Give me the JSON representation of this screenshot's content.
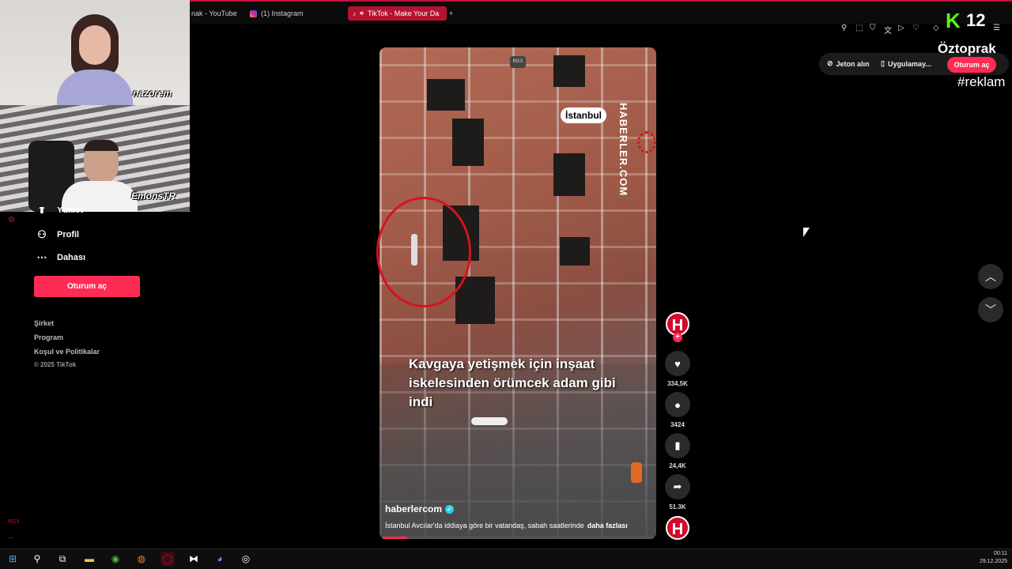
{
  "browser": {
    "tabs": [
      {
        "label": "nak - YouTube",
        "icon": "youtube-icon"
      },
      {
        "label": "(1) Instagram",
        "icon": "instagram-icon"
      },
      {
        "label": "TikTok - Make Your Da",
        "icon": "tiktok-icon",
        "active": true
      }
    ],
    "new_tab": "+"
  },
  "webcams": {
    "cam1_label": "nazorem",
    "cam2_label": "EmonsTR"
  },
  "sidebar": {
    "partial_item": "Yüklet",
    "items": [
      {
        "label": "Profil",
        "icon": "person-icon"
      },
      {
        "label": "Dahası",
        "icon": "more-icon"
      }
    ],
    "login_button": "Oturum aç",
    "footer_links": [
      "Şirket",
      "Program",
      "Koşul ve Politikalar"
    ],
    "copyright": "© 2025 TikTok"
  },
  "video": {
    "headline": "Kavgaya yetişmek için inşaat iskelesinden örümcek adam gibi indi",
    "location_tag": "İstanbul",
    "watermark": "HABERLER.COM",
    "corner_tag": "RGX",
    "author": "haberlercom",
    "caption": "İstanbul Avcılar'da iddiaya göre bir vatandaş, sabah saatlerinde",
    "more_link": "daha fazlası",
    "progress": 0.09
  },
  "actions": {
    "avatar_letter": "H",
    "follow": "+",
    "likes": "334,5K",
    "comments": "3424",
    "bookmarks": "24,4K",
    "shares": "51.3K"
  },
  "header_right": {
    "coins": "Jeton alın",
    "app": "Uygulamay...",
    "login": "Oturum aç"
  },
  "overlay": {
    "stream_letter": "K",
    "stream_number": "12",
    "brand": "Öztoprak",
    "hashtag": "#reklam"
  },
  "taskbar": {
    "time": "00:11",
    "date": "29.12.2025"
  },
  "colors": {
    "accent": "#fe2c55",
    "kick_green": "#53fc18",
    "verified": "#20d5ec"
  }
}
